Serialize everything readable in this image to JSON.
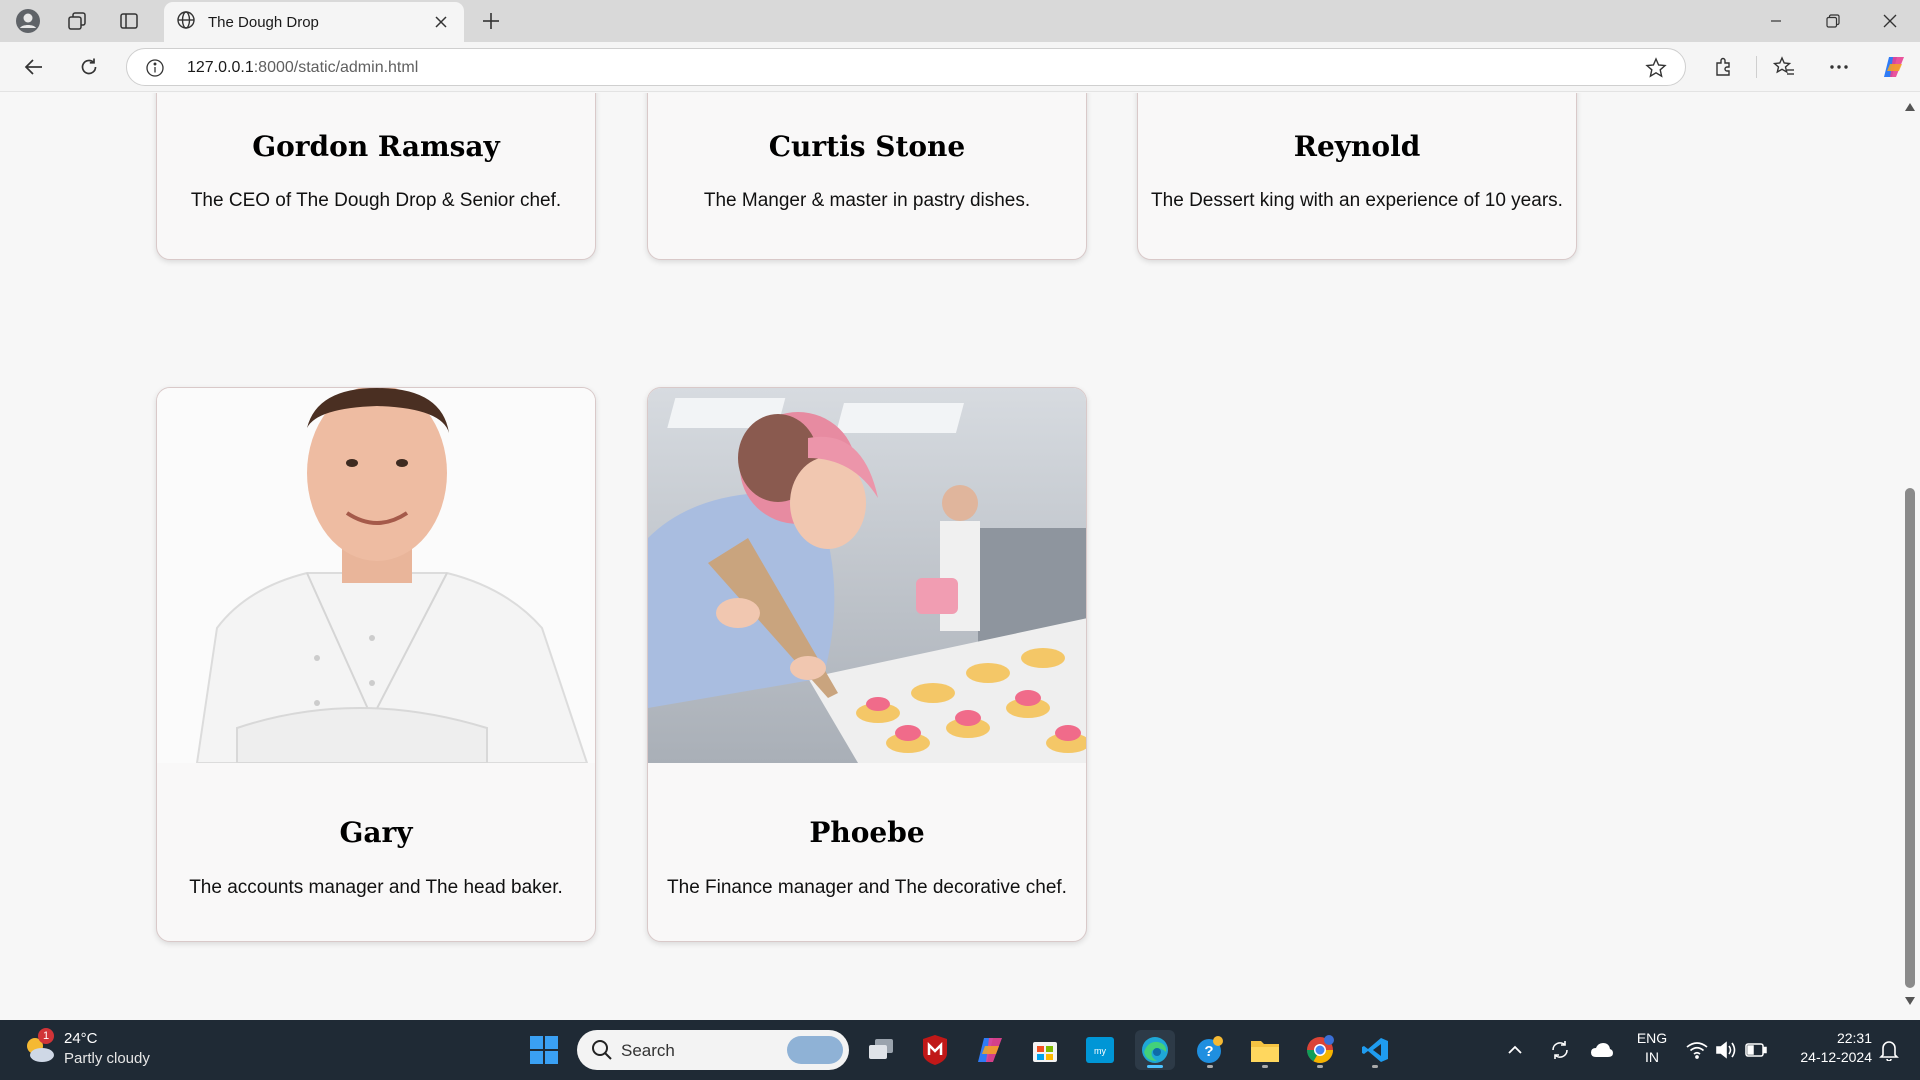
{
  "browser": {
    "tab_title": "The Dough Drop",
    "url_host": "127.0.0.1",
    "url_rest": ":8000/static/admin.html"
  },
  "team": {
    "top_row": [
      {
        "name": "Gordon Ramsay",
        "description": "The CEO of The Dough Drop & Senior chef."
      },
      {
        "name": "Curtis Stone",
        "description": "The Manger & master in pastry dishes."
      },
      {
        "name": "Reynold",
        "description": "The Dessert king with an experience of 10 years."
      }
    ],
    "bottom_row": [
      {
        "name": "Gary",
        "description": "The accounts manager and The head baker."
      },
      {
        "name": "Phoebe",
        "description": "The Finance manager and The decorative chef."
      }
    ]
  },
  "taskbar": {
    "weather_temp": "24°C",
    "weather_desc": "Partly cloudy",
    "weather_badge": "1",
    "search_label": "Search",
    "lang_line1": "ENG",
    "lang_line2": "IN",
    "time": "22:31",
    "date": "24-12-2024"
  },
  "colors": {
    "accent": "#0078d4",
    "taskbar": "#1f2a35"
  }
}
